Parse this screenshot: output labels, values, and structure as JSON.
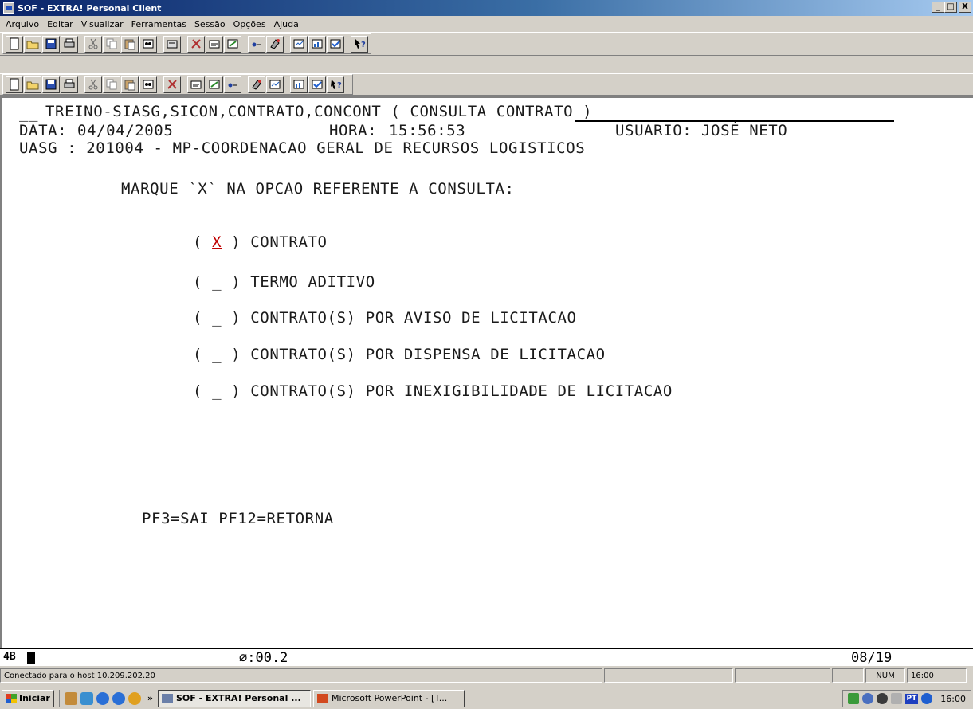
{
  "window": {
    "title": "SOF - EXTRA! Personal Client",
    "controls": {
      "minimize": "_",
      "maximize": "□",
      "close": "X"
    }
  },
  "menu": [
    "Arquivo",
    "Editar",
    "Visualizar",
    "Ferramentas",
    "Sessão",
    "Opções",
    "Ajuda"
  ],
  "toolbar_icons": {
    "row1": [
      "new-icon",
      "open-icon",
      "save-icon",
      "print-icon",
      "cut-icon",
      "copy-icon",
      "paste-icon",
      "find-icon",
      "open-folder-icon",
      "tools-icon",
      "macro-icon",
      "edit-icon",
      "record-icon",
      "settings-icon",
      "reports-icon",
      "chart-icon",
      "check-icon",
      "help-icon"
    ],
    "row2": [
      "new-icon",
      "open-icon",
      "save-icon",
      "print-icon",
      "cut-icon",
      "copy-icon",
      "paste-icon",
      "find-icon",
      "tools-icon",
      "macro-icon",
      "edit-icon",
      "record-icon",
      "settings-icon",
      "reports-icon",
      "chart-icon",
      "check-icon",
      "help-icon"
    ]
  },
  "terminal": {
    "header_prefix": "__",
    "header_path": "TREINO-SIASG,SICON,CONTRATO,CONCONT ( CONSULTA CONTRATO )",
    "date_label": "DATA:",
    "date_value": "04/04/2005",
    "time_label": "HORA:",
    "time_value": "15:56:53",
    "user_label": "USUARIO:",
    "user_value": "JOSÉ NETO",
    "uasg_line": "UASG : 201004 - MP-COORDENACAO GERAL DE RECURSOS LOGISTICOS",
    "instruction": "MARQUE `X` NA OPCAO REFERENTE A CONSULTA:",
    "options": [
      {
        "mark": "X",
        "label": "CONTRATO"
      },
      {
        "mark": "_",
        "label": "TERMO ADITIVO"
      },
      {
        "mark": "_",
        "label": "CONTRATO(S) POR AVISO DE LICITACAO"
      },
      {
        "mark": "_",
        "label": "CONTRATO(S) POR DISPENSA DE LICITACAO"
      },
      {
        "mark": "_",
        "label": "CONTRATO(S) POR INEXIGIBILIDADE DE LICITACAO"
      }
    ],
    "pf_keys": "PF3=SAI PF12=RETORNA"
  },
  "oia": {
    "indicator": "4B",
    "timer": "⌀:00.2",
    "cursor_position": "08/19"
  },
  "status": {
    "connection": "Conectado para o host 10.209.202.20",
    "num": "NUM",
    "time": "16:00"
  },
  "taskbar": {
    "start": "Iniciar",
    "chevron": "»",
    "tasks": [
      "SOF - EXTRA! Personal ...",
      "Microsoft PowerPoint - [T..."
    ],
    "tray_lang": "PT",
    "clock": "16:00"
  }
}
